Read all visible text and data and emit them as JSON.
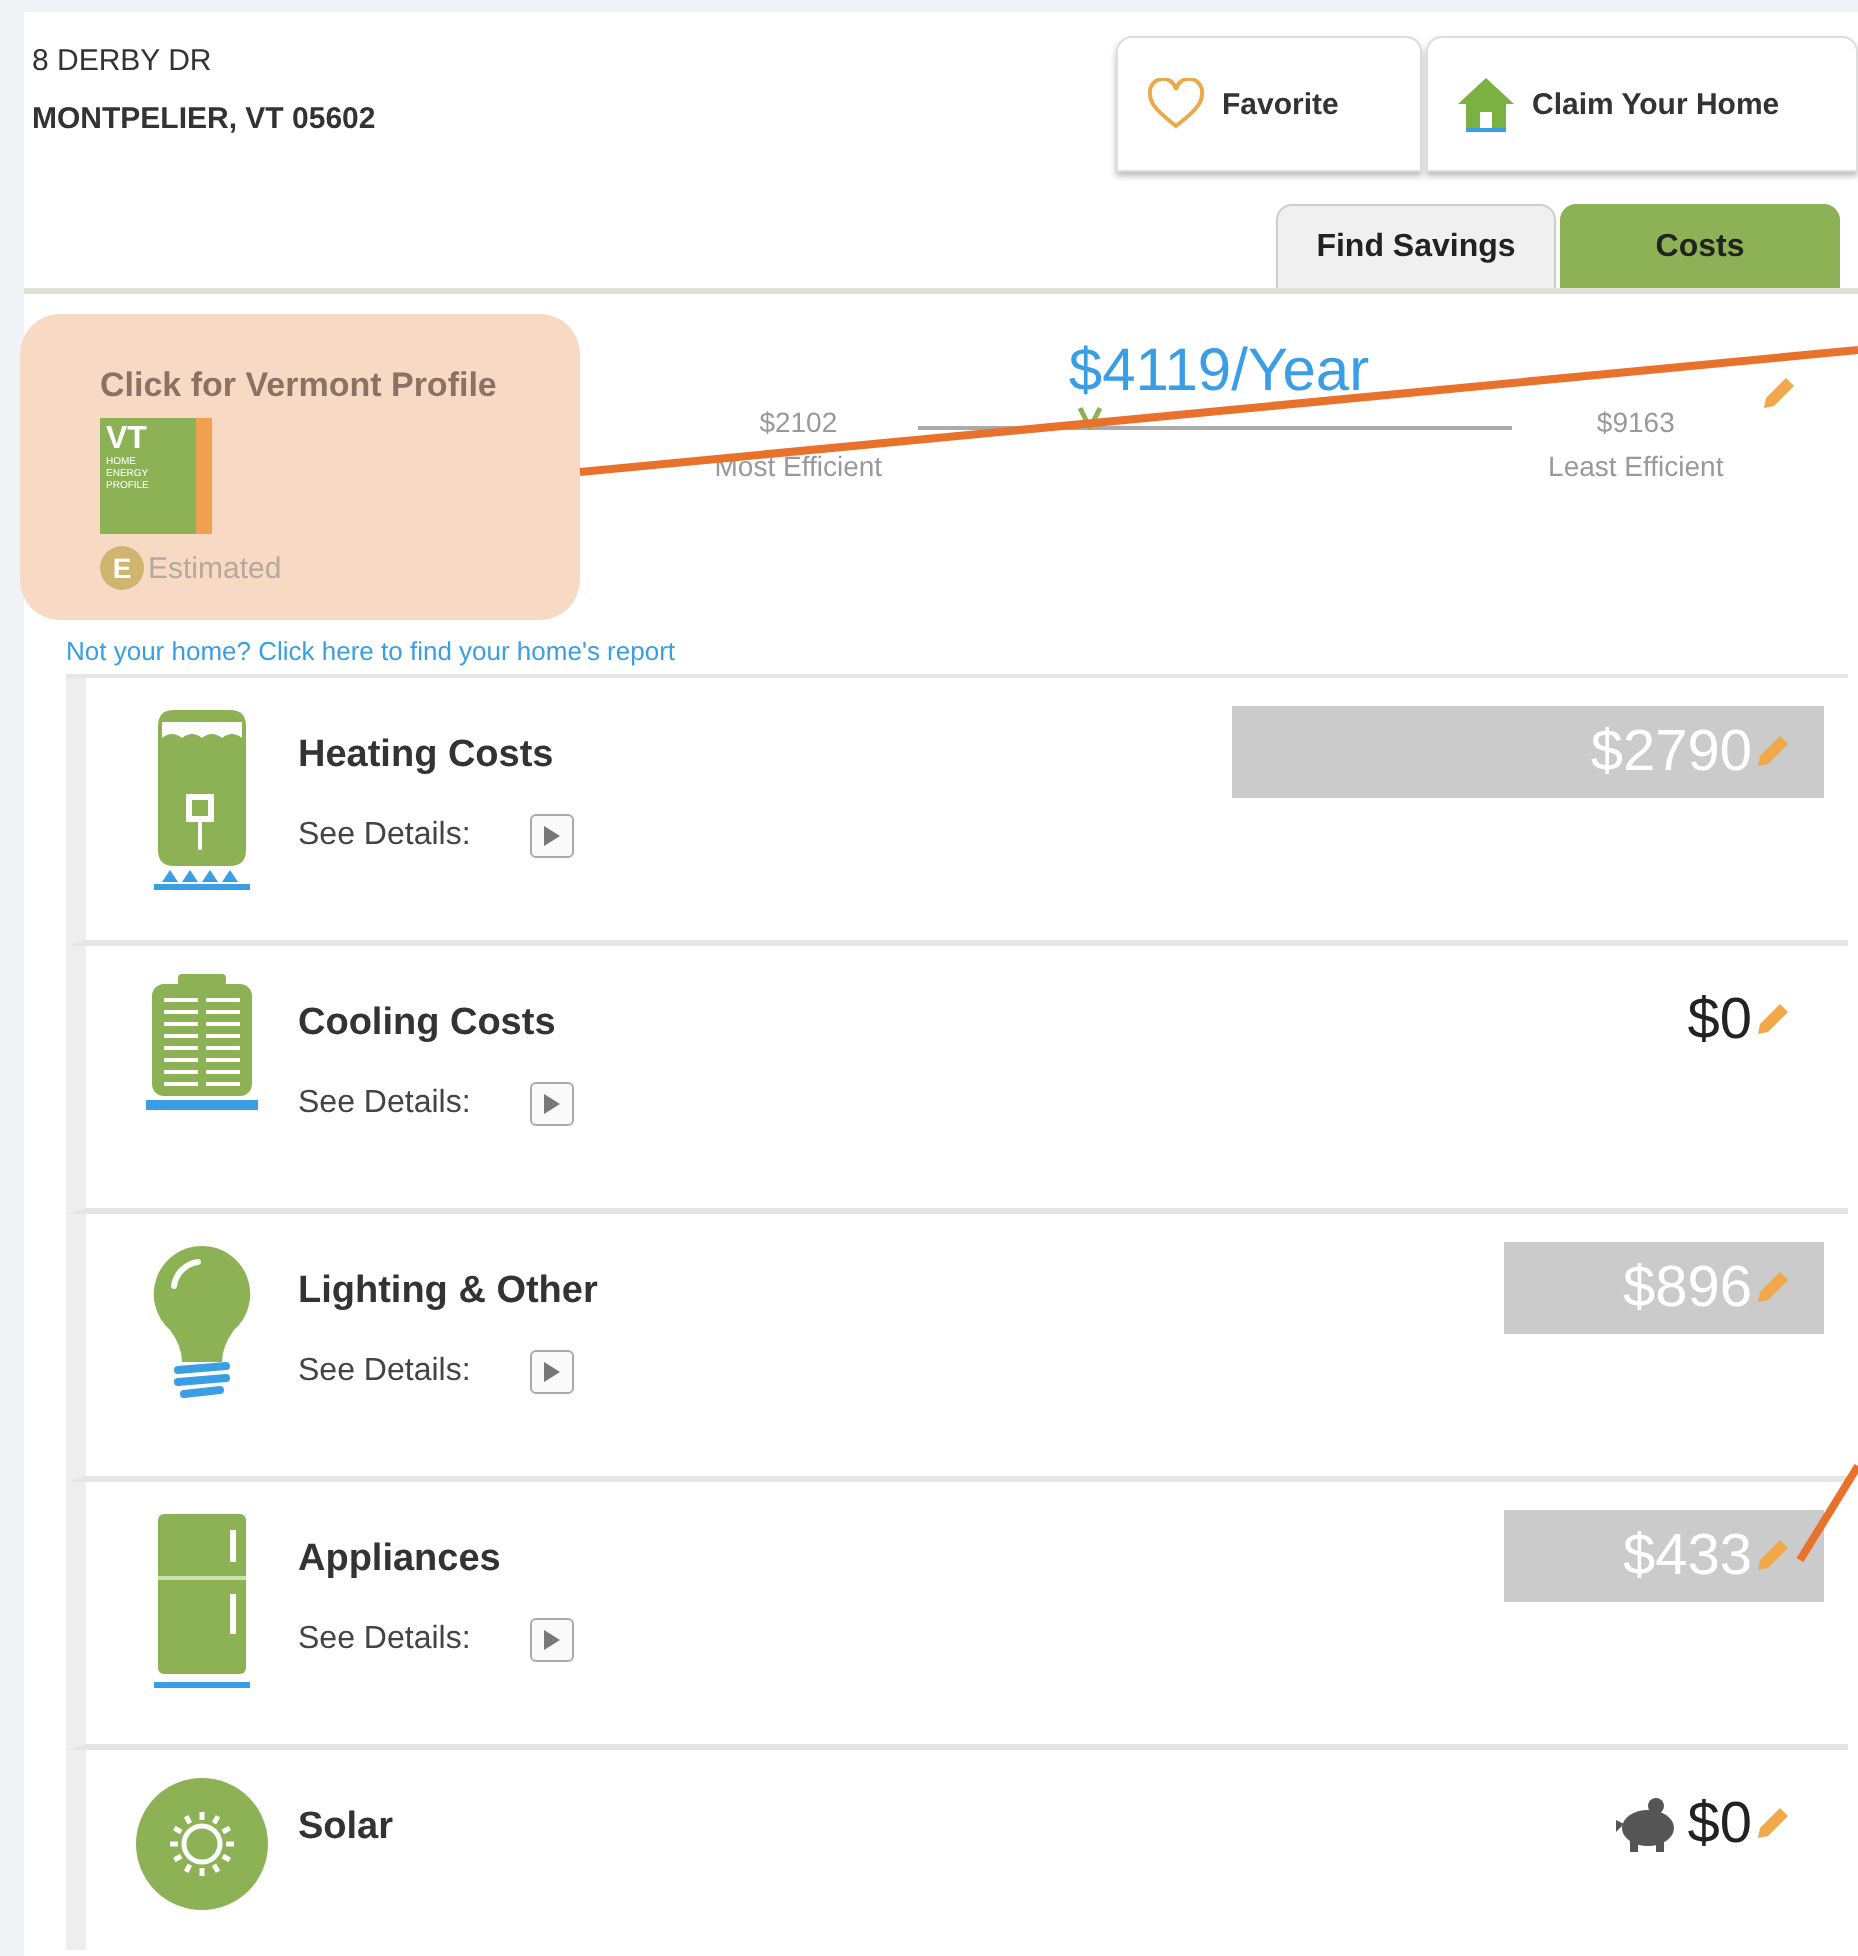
{
  "address": {
    "street": "8 DERBY DR",
    "city": "MONTPELIER, VT 05602"
  },
  "actions": [
    {
      "kind": "favorite",
      "label": "Favorite"
    },
    {
      "kind": "claim",
      "label": "Claim Your Home"
    }
  ],
  "tabs": [
    {
      "label": "Find Savings",
      "selected": false
    },
    {
      "label": "Costs",
      "selected": true
    }
  ],
  "profile": {
    "title": "Click for Vermont Profile",
    "logo_title": "VT",
    "logo_subtitle": "HOME ENERGY PROFILE",
    "badge": "E",
    "badge_label": "Estimated"
  },
  "summary": {
    "total": "$4119/Year",
    "min": "$2102",
    "min_label": "Most Efficient",
    "max": "$9163",
    "max_label": "Least Efficient",
    "level": 0.29
  },
  "link": "Not your home? Click here to find your home's report",
  "categories": [
    {
      "kind": "heating",
      "title": "Heating Costs",
      "details": "See Details:",
      "amount": "$2790",
      "highlighted": true
    },
    {
      "kind": "cooling",
      "title": "Cooling Costs",
      "details": "See Details:",
      "amount": "$0",
      "highlighted": false
    },
    {
      "kind": "lighting",
      "title": "Lighting & Other",
      "details": "See Details:",
      "amount": "$896",
      "highlighted": true
    },
    {
      "kind": "appliances",
      "title": "Appliances",
      "details": "See Details:",
      "amount": "$433",
      "highlighted": true
    },
    {
      "kind": "solar",
      "title": "Solar",
      "amount": "$0",
      "highlighted": false
    }
  ]
}
